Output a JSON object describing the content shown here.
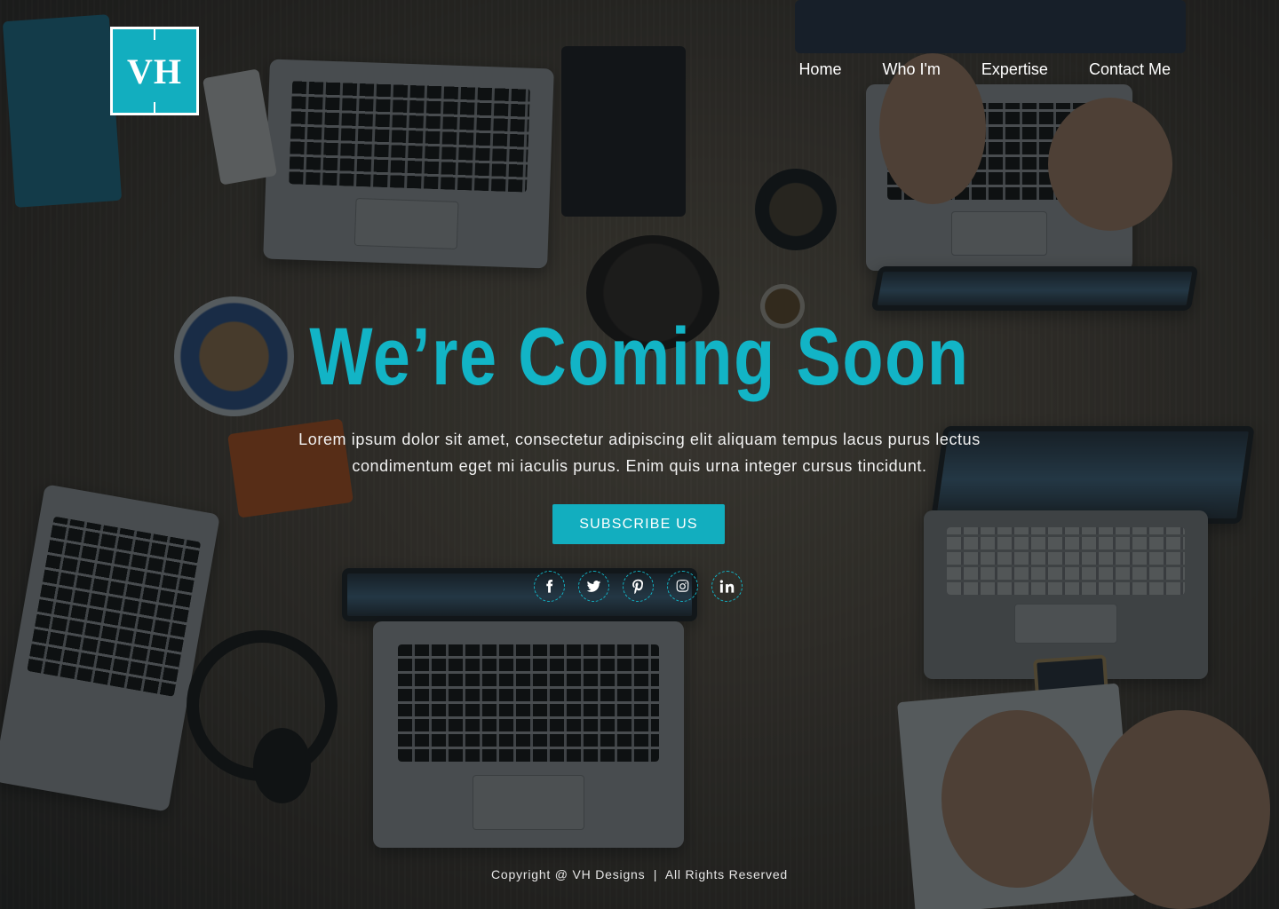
{
  "brand": {
    "logo_text": "VH",
    "accent_color": "#12aebf"
  },
  "nav": {
    "items": [
      {
        "label": "Home"
      },
      {
        "label": "Who I'm"
      },
      {
        "label": "Expertise"
      },
      {
        "label": "Contact Me"
      }
    ]
  },
  "hero": {
    "headline": "We’re Coming Soon",
    "description": "Lorem ipsum dolor sit amet, consectetur adipiscing elit aliquam tempus lacus purus lectus condimentum eget mi iaculis purus. Enim quis urna integer cursus tincidunt.",
    "cta_label": "SUBSCRIBE US"
  },
  "socials": [
    {
      "icon": "facebook-icon"
    },
    {
      "icon": "twitter-icon"
    },
    {
      "icon": "pinterest-icon"
    },
    {
      "icon": "instagram-icon"
    },
    {
      "icon": "linkedin-icon"
    }
  ],
  "footer": {
    "copyright": "Copyright @ VH Designs  |  All Rights Reserved"
  }
}
